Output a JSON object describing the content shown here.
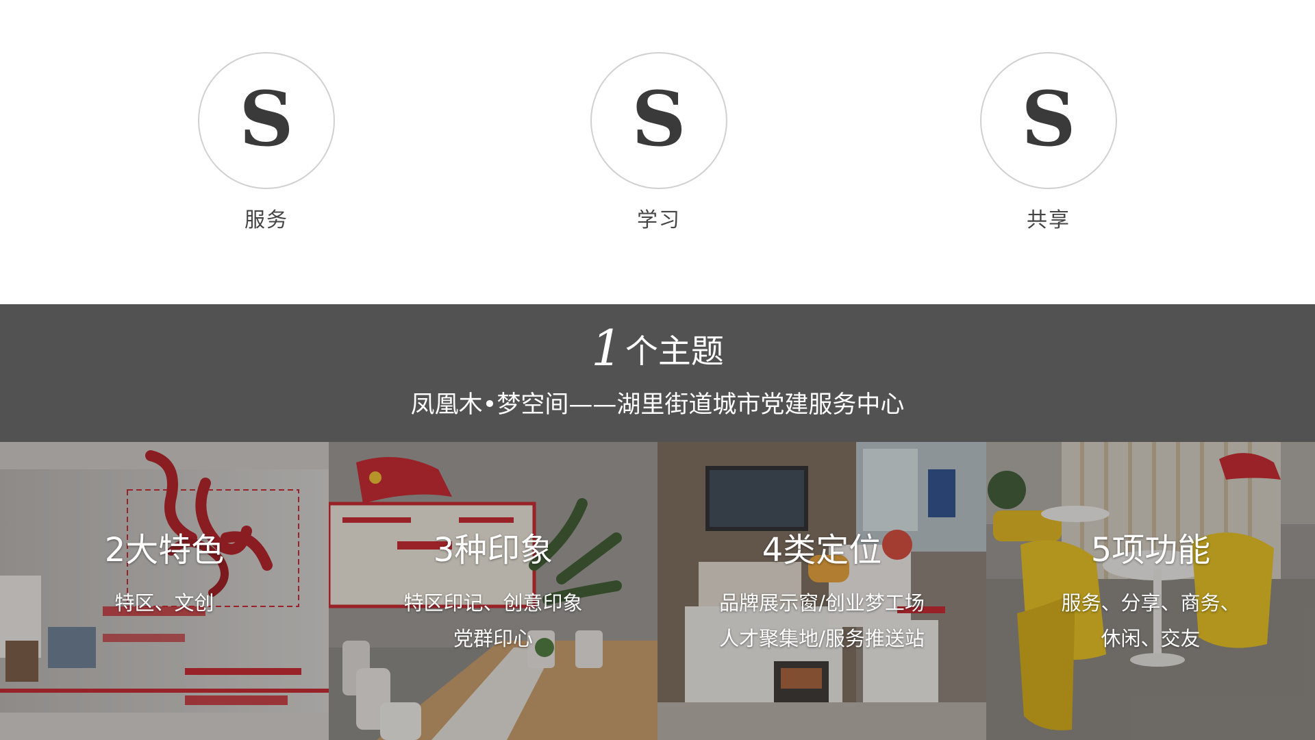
{
  "pillars": [
    {
      "letter": "S",
      "label": "服务"
    },
    {
      "letter": "S",
      "label": "学习"
    },
    {
      "letter": "S",
      "label": "共享"
    }
  ],
  "theme": {
    "number": "1",
    "title": "个主题",
    "subtitle": "凤凰木•梦空间——湖里街道城市党建服务中心"
  },
  "panels": [
    {
      "number": "2",
      "title": "大特色",
      "lines": [
        "特区、文创",
        ""
      ],
      "photo": "exhibition-wall-photo"
    },
    {
      "number": "3",
      "title": "种印象",
      "lines": [
        "特区印记、创意印象",
        "党群印心"
      ],
      "photo": "meeting-room-photo"
    },
    {
      "number": "4",
      "title": "类定位",
      "lines": [
        "品牌展示窗/创业梦工场",
        "人才聚集地/服务推送站"
      ],
      "photo": "display-hall-photo"
    },
    {
      "number": "5",
      "title": "项功能",
      "lines": [
        "服务、分享、商务、",
        "休闲、交友"
      ],
      "photo": "lounge-photo"
    }
  ],
  "colors": {
    "band": "#525252",
    "circle_border": "#d0d0d0",
    "letter": "#3a3a3a",
    "accent_red": "#c8252b",
    "chair_yellow": "#e9c21e"
  }
}
